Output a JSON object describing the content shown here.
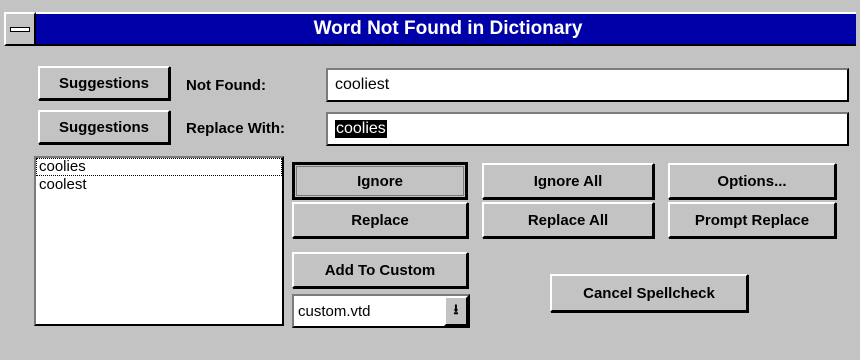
{
  "window": {
    "title": "Word Not Found in Dictionary",
    "system_menu": "system-menu"
  },
  "form": {
    "suggestions_btn_1": "Suggestions",
    "suggestions_btn_2": "Suggestions",
    "not_found_label": "Not Found:",
    "not_found_value": "cooliest",
    "replace_with_label": "Replace With:",
    "replace_with_value": "coolies"
  },
  "suggestions_list": [
    {
      "text": "coolies",
      "selected": true
    },
    {
      "text": "coolest",
      "selected": false
    }
  ],
  "buttons": {
    "ignore": "Ignore",
    "ignore_all": "Ignore All",
    "options": "Options...",
    "replace": "Replace",
    "replace_all": "Replace All",
    "prompt_replace": "Prompt Replace",
    "add_to_custom": "Add To Custom",
    "cancel_spellcheck": "Cancel Spellcheck"
  },
  "custom_dictionary": {
    "selected": "custom.vtd",
    "arrow_glyph": "⭳"
  },
  "colors": {
    "title_bar": "#0000a8",
    "dialog_bg": "#c3c3c3"
  }
}
